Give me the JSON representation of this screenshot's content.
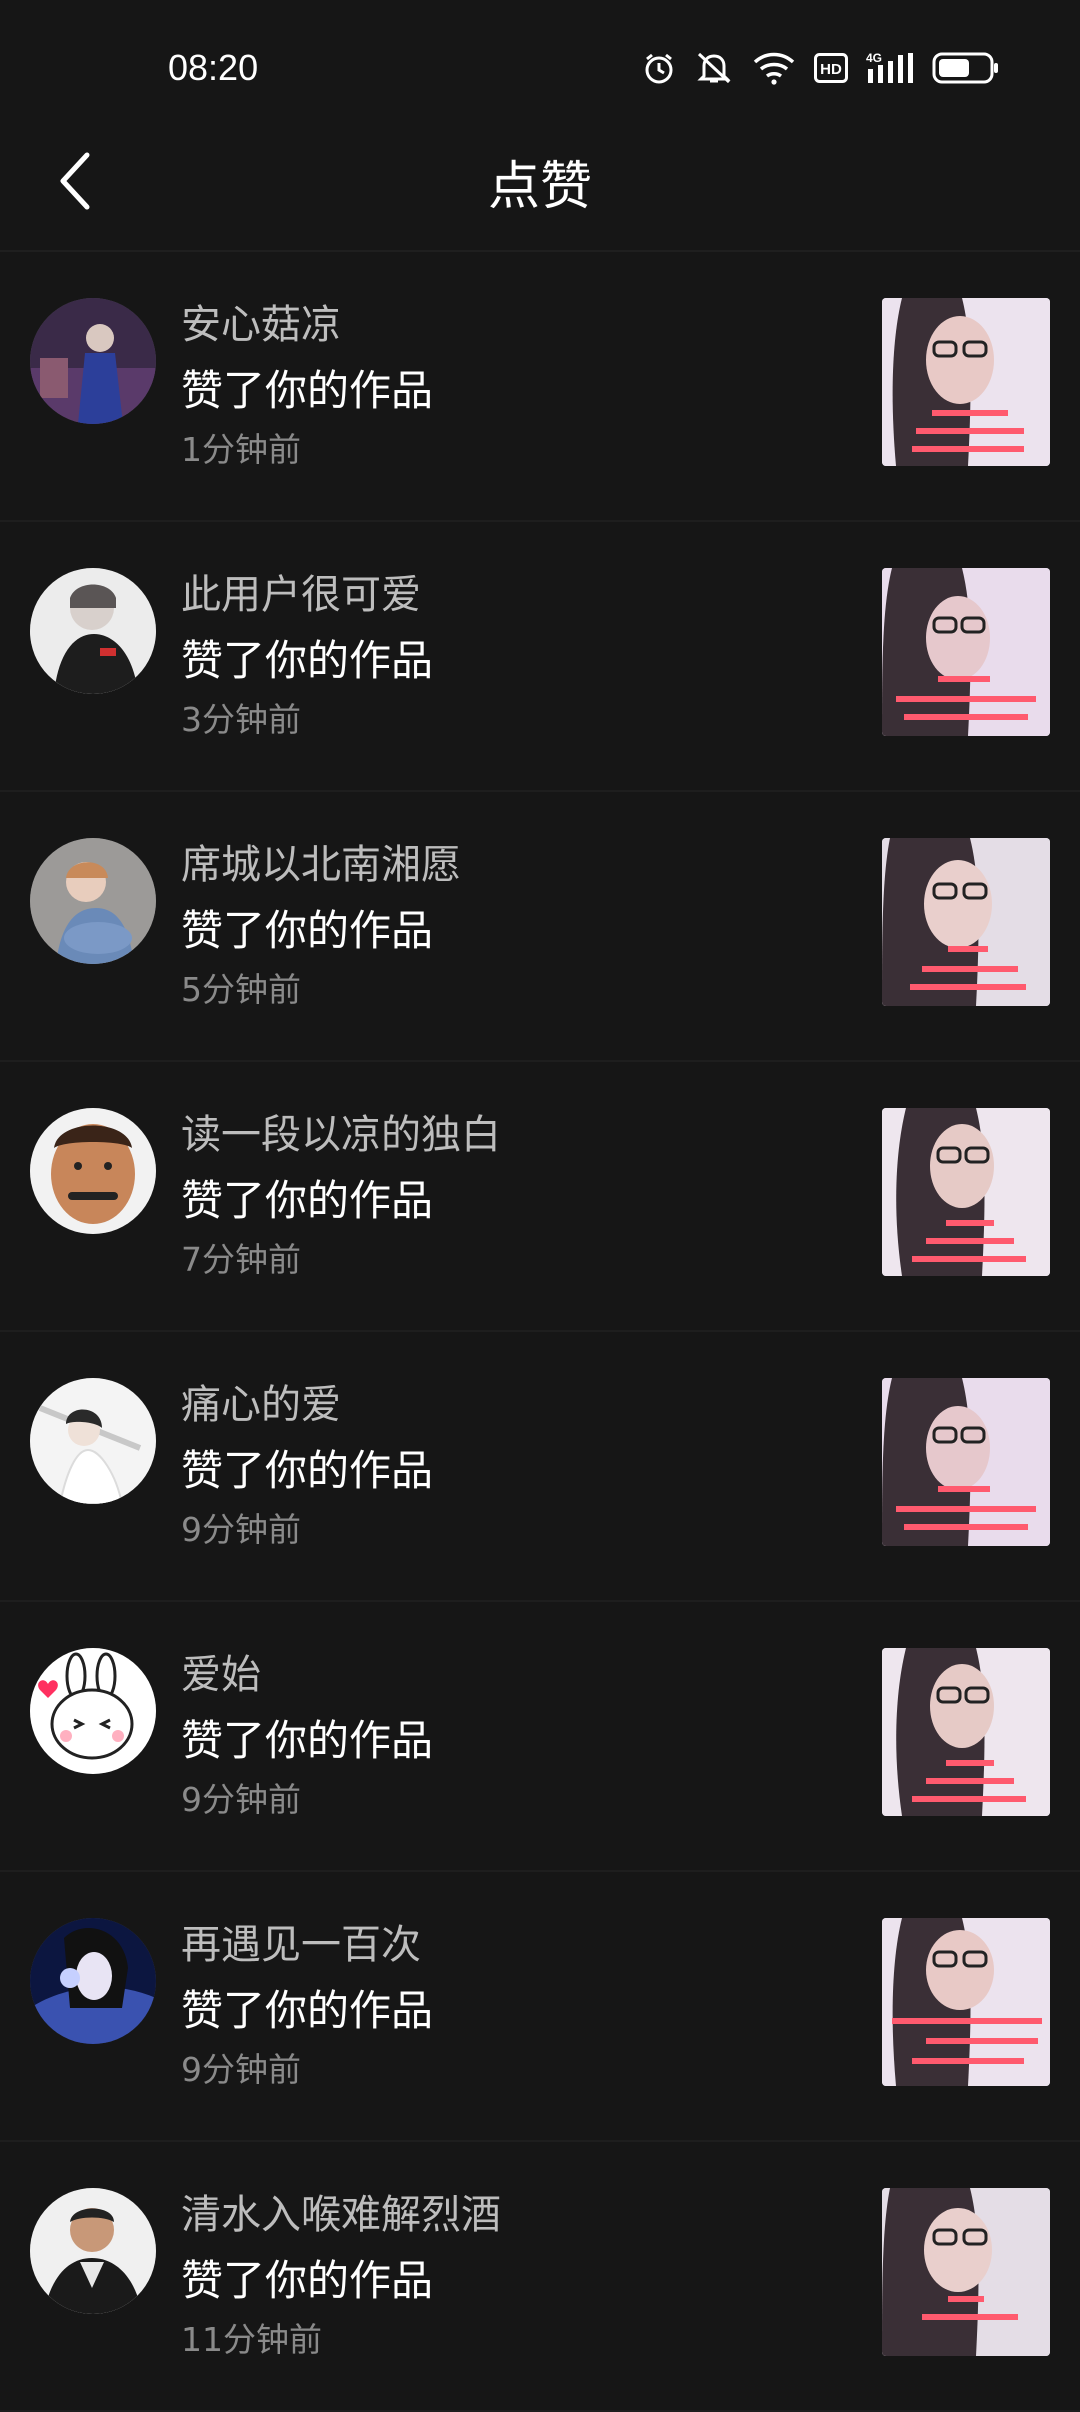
{
  "status_bar": {
    "time": "08:20",
    "icons": [
      "alarm-icon",
      "mute-icon",
      "wifi-icon",
      "hd-icon",
      "signal-4g-icon",
      "battery-icon"
    ]
  },
  "header": {
    "title": "点赞",
    "back_icon": "back-arrow-icon"
  },
  "colors": {
    "background": "#161616",
    "name": "#bdbdbd",
    "action": "#ffffff",
    "time": "#8a8a8a",
    "divider": "#1e1e1e"
  },
  "likes": [
    {
      "name": "安心菇凉",
      "action": "赞了你的作品",
      "time": "1分钟前"
    },
    {
      "name": "此用户很可爱",
      "action": "赞了你的作品",
      "time": "3分钟前"
    },
    {
      "name": "席城以北南湘愿",
      "action": "赞了你的作品",
      "time": "5分钟前"
    },
    {
      "name": "读一段以凉的独白",
      "action": "赞了你的作品",
      "time": "7分钟前"
    },
    {
      "name": "痛心的爱",
      "action": "赞了你的作品",
      "time": "9分钟前"
    },
    {
      "name": "爱始",
      "action": "赞了你的作品",
      "time": "9分钟前"
    },
    {
      "name": "再遇见一百次",
      "action": "赞了你的作品",
      "time": "9分钟前"
    },
    {
      "name": "清水入喉难解烈酒",
      "action": "赞了你的作品",
      "time": "11分钟前"
    }
  ]
}
